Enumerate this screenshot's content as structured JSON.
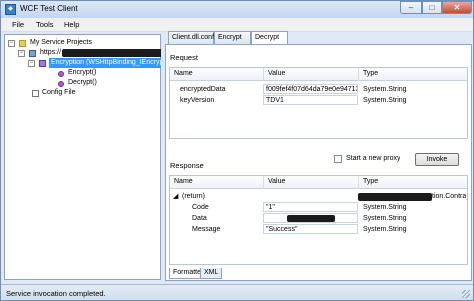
{
  "window": {
    "title": "WCF Test Client"
  },
  "menu": [
    "File",
    "Tools",
    "Help"
  ],
  "tree": {
    "root": "My Service Projects",
    "endpoint_prefix": "https://",
    "binding": "Encryption (WSHttpBinding_IEncrypt",
    "methods": [
      "Encrypt()",
      "Decrypt()"
    ],
    "config_file": "Config File"
  },
  "tabs": [
    "Client.dll.config",
    "Encrypt (1)",
    "Decrypt (1)"
  ],
  "request": {
    "title": "Request",
    "columns": [
      "Name",
      "Value",
      "Type"
    ],
    "rows": [
      {
        "name": "encryptedData",
        "value": "f009fef4f07d64da79e0e94713b4",
        "type": "System.String"
      },
      {
        "name": "keyVersion",
        "value": "TDV1",
        "type": "System.String"
      }
    ]
  },
  "start_new_proxy": {
    "label": "Start a new proxy",
    "checked": false
  },
  "invoke_label": "Invoke",
  "response": {
    "title": "Response",
    "columns": [
      "Name",
      "Value",
      "Type"
    ],
    "root": {
      "name": "(return)",
      "type_suffix": "tion.Contrac"
    },
    "rows": [
      {
        "name": "Code",
        "value": "\"1\"",
        "type": "System.String"
      },
      {
        "name": "Data",
        "value": "",
        "type": "System.String"
      },
      {
        "name": "Message",
        "value": "\"Success\"",
        "type": "System.String"
      }
    ]
  },
  "bottom_tabs": [
    "Formatted",
    "XML"
  ],
  "status": "Service invocation completed."
}
